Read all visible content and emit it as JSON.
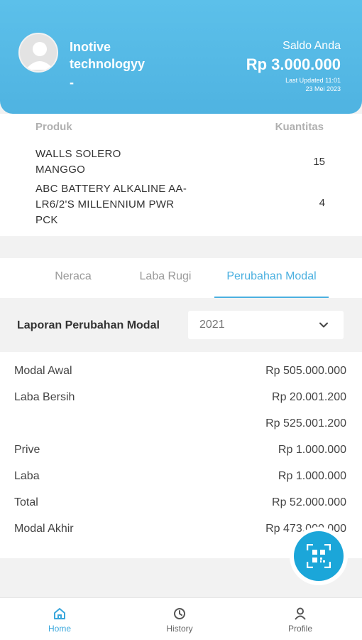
{
  "header": {
    "user_name": "Inotive technologyy",
    "user_sub": "-",
    "saldo_label": "Saldo Anda",
    "saldo_value": "Rp 3.000.000",
    "updated_line1": "Last Updated 11:01",
    "updated_line2": "23 Mei 2023"
  },
  "products": {
    "col_product": "Produk",
    "col_qty": "Kuantitas",
    "items": [
      {
        "name": " WALLS SOLERO MANGGO",
        "qty": "15"
      },
      {
        "name": "ABC BATTERY ALKALINE AA-LR6/2'S MILLENNIUM PWR PCK",
        "qty": "4"
      }
    ]
  },
  "tabs": [
    {
      "label": "Neraca",
      "active": false
    },
    {
      "label": "Laba Rugi",
      "active": false
    },
    {
      "label": "Perubahan Modal",
      "active": true
    }
  ],
  "report": {
    "title": "Laporan Perubahan Modal",
    "year": "2021",
    "icon": "chevron-down-icon"
  },
  "ledger": [
    {
      "label": "Modal Awal",
      "value": "Rp 505.000.000"
    },
    {
      "label": "Laba Bersih",
      "value": "Rp 20.001.200"
    },
    {
      "label": "",
      "value": "Rp 525.001.200"
    },
    {
      "label": "Prive",
      "value": "Rp 1.000.000"
    },
    {
      "label": "Laba",
      "value": "Rp 1.000.000"
    },
    {
      "label": "Total",
      "value": "Rp 52.000.000"
    },
    {
      "label": "Modal Akhir",
      "value": "Rp 473.000.000"
    }
  ],
  "fab": {
    "icon": "qr-scan-icon"
  },
  "nav": [
    {
      "label": "Home",
      "icon": "home-icon",
      "active": true
    },
    {
      "label": "History",
      "icon": "history-icon",
      "active": false
    },
    {
      "label": "Profile",
      "icon": "profile-icon",
      "active": false
    }
  ],
  "colors": {
    "accent": "#4bb0e0",
    "header": "#5cc0ea",
    "fab": "#1ba6d9"
  }
}
